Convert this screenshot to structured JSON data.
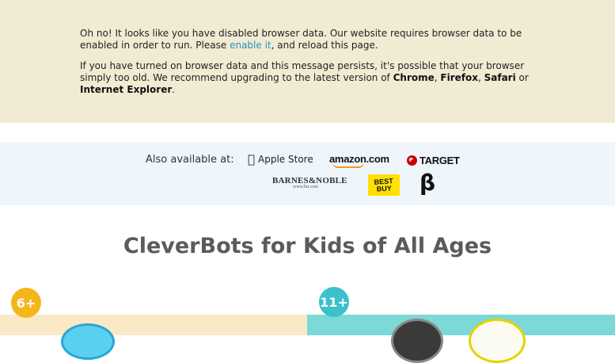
{
  "notice": {
    "p1_text": "Oh no! It looks like you have disabled browser data. Our website requires browser data to be enabled in order to run. Please ",
    "p1_link": "enable it",
    "p1_suffix": ", and reload this page.",
    "p2_text": "If you have turned on browser data and this message persists, it's possible that your browser simply too old. We recommend upgrading to the latest version of ",
    "browsers": [
      "Chrome",
      "Firefox",
      "Safari",
      "Internet Explorer"
    ],
    "sep_comma": ", ",
    "sep_or": " or ",
    "end": "."
  },
  "availability": {
    "label": "Also available at:",
    "stores": {
      "apple": "Apple Store",
      "amazon": "amazon.com",
      "target": "TARGET",
      "barnes": "BARNES&NOBLE",
      "barnes_sub": "www.bn.com",
      "bestbuy": "BEST BUY",
      "beta": "β"
    }
  },
  "heading": "CleverBots for Kids of All Ages",
  "cards": {
    "left_badge": "6+",
    "right_badge": "11+"
  },
  "colors": {
    "notice_bg": "#f1ebd4",
    "link": "#2a8fbd",
    "avail_bg": "#eef5fb",
    "badge_left": "#f5b61c",
    "badge_right": "#3cc0cc"
  }
}
